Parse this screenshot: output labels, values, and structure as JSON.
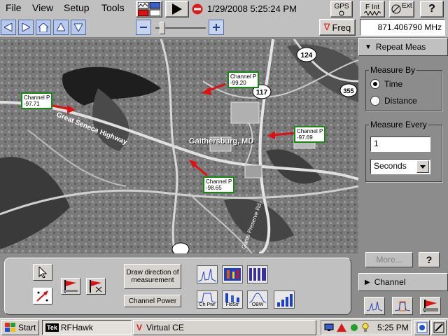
{
  "menu": {
    "file": "File",
    "view": "View",
    "setup": "Setup",
    "tools": "Tools"
  },
  "status": {
    "datetime": "1/29/2008 5:25:24 PM",
    "frequency": "871.406790 MHz"
  },
  "toolbar": {
    "gps_label": "GPS",
    "fint_label": "F Int",
    "ext_label": "Ext",
    "help_label": "?",
    "freq_label": "Freq",
    "freq_marker": "∇"
  },
  "map": {
    "city_label": "Gaithersburg, MD",
    "markers": [
      {
        "title": "Channel P",
        "value": "-97.71"
      },
      {
        "title": "Channel P",
        "value": "-99.20"
      },
      {
        "title": "Channel P",
        "value": "-97.69"
      },
      {
        "title": "Channel P",
        "value": "-98.65"
      }
    ],
    "road_labels": {
      "route_124": "124",
      "route_117": "117",
      "route_355": "355"
    },
    "street_labels": [
      "Great Seneca Highway",
      "Game Preserve Rd"
    ]
  },
  "panel": {
    "repeat_meas": "Repeat Meas",
    "measure_by": "Measure By",
    "opt_time": "Time",
    "opt_distance": "Distance",
    "measure_every": "Measure Every",
    "every_value": "1",
    "unit_value": "Seconds",
    "more": "More...",
    "help": "?",
    "channel": "Channel"
  },
  "controls": {
    "draw_direction": "Draw direction of measurement",
    "channel_power": "Channel Power",
    "mode_labels": {
      "ch_pwr": "Ch Pwr",
      "fldstr": "FldStr",
      "obw": "OBW"
    }
  },
  "taskbar": {
    "start": "Start",
    "app1": "RFHawk",
    "app1_prefix": "Tek",
    "app2": "Virtual CE",
    "app2_prefix": "V",
    "clock": "5:25 PM"
  },
  "colors": {
    "marker_border": "#138a13",
    "arrow": "#dd1111",
    "accent_blue": "#3a5fcd"
  }
}
